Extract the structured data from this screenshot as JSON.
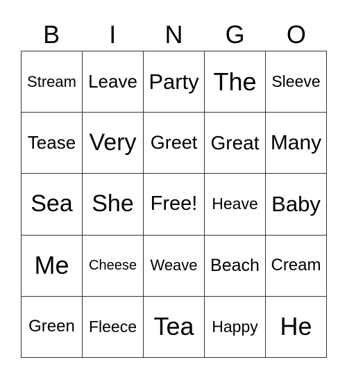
{
  "header": [
    "B",
    "I",
    "N",
    "G",
    "O"
  ],
  "cells": [
    "Stream",
    "Leave",
    "Party",
    "The",
    "Sleeve",
    "Tease",
    "Very",
    "Greet",
    "Great",
    "Many",
    "Sea",
    "She",
    "Free!",
    "Heave",
    "Baby",
    "Me",
    "Cheese",
    "Weave",
    "Beach",
    "Cream",
    "Green",
    "Fleece",
    "Tea",
    "Happy",
    "He"
  ]
}
